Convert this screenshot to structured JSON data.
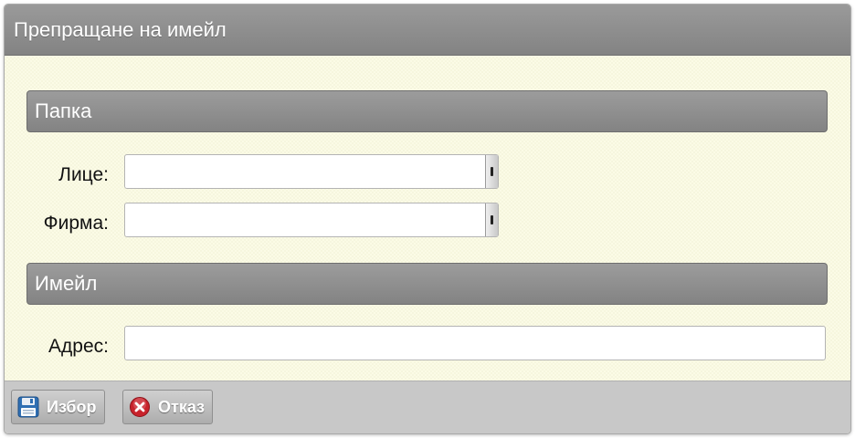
{
  "dialog": {
    "title": "Препращане на имейл"
  },
  "sections": {
    "folder": {
      "title": "Папка",
      "person_label": "Лице:",
      "person_value": "",
      "company_label": "Фирма:",
      "company_value": ""
    },
    "email": {
      "title": "Имейл",
      "address_label": "Адрес:",
      "address_value": "",
      "address_placeholder": ""
    }
  },
  "footer": {
    "select_label": "Избор",
    "select_icon": "floppy-disk-icon",
    "cancel_label": "Отказ",
    "cancel_icon": "red-x-circle-icon"
  },
  "colors": {
    "header_gray": "#8e8e8e",
    "body_background": "#fbfbe6",
    "footer_gray": "#c8c8c8",
    "cancel_red": "#c8232c"
  }
}
